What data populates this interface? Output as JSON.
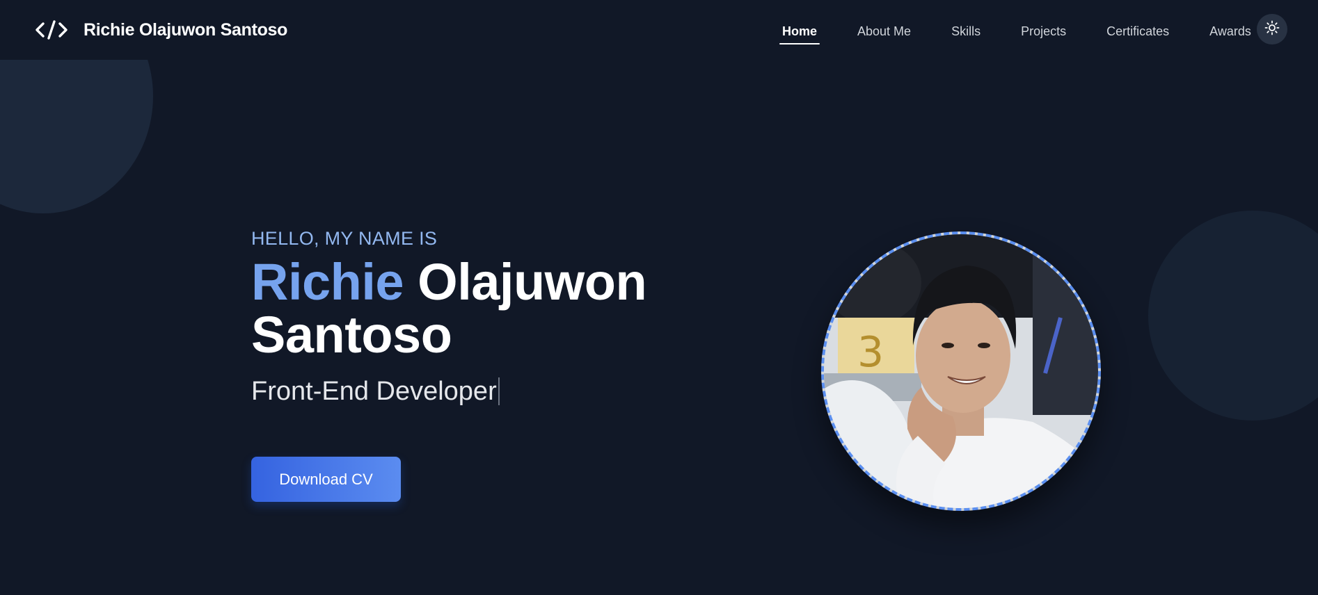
{
  "header": {
    "brand_icon": "code-brackets-icon",
    "brand_name": "Richie Olajuwon Santoso",
    "nav": [
      {
        "label": "Home",
        "active": true
      },
      {
        "label": "About Me",
        "active": false
      },
      {
        "label": "Skills",
        "active": false
      },
      {
        "label": "Projects",
        "active": false
      },
      {
        "label": "Certificates",
        "active": false
      },
      {
        "label": "Awards",
        "active": false
      }
    ],
    "theme_toggle_icon": "sun-icon"
  },
  "hero": {
    "greeting": "HELLO, MY NAME IS",
    "first_name": "Richie",
    "rest_name_line1": "Olajuwon",
    "rest_name_line2": "Santoso",
    "role": "Front-End Developer",
    "cta_label": "Download CV",
    "photo_icon": "profile-photo"
  },
  "colors": {
    "background": "#111827",
    "accent": "#76a3ee",
    "greeting": "#93b8f0",
    "button_start": "#3563e0",
    "button_end": "#5b8cf0",
    "photo_border": "#5b8ff0"
  }
}
